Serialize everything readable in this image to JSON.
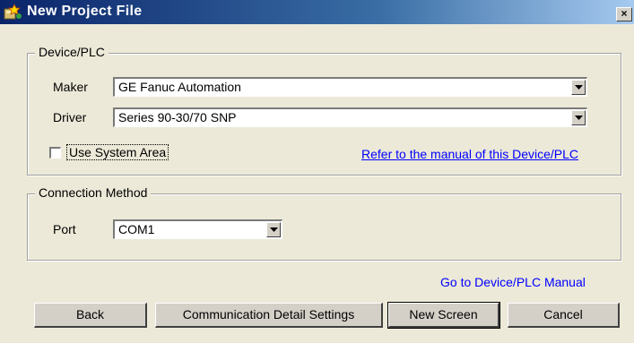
{
  "window": {
    "title": "New Project File",
    "close_label": "×"
  },
  "device_group": {
    "legend": "Device/PLC",
    "maker_label": "Maker",
    "maker_value": "GE Fanuc Automation",
    "driver_label": "Driver",
    "driver_value": "Series 90-30/70 SNP",
    "use_system_area_label": "Use System Area",
    "use_system_area_checked": false,
    "manual_link": "Refer to the manual of this Device/PLC"
  },
  "connection_group": {
    "legend": "Connection Method",
    "port_label": "Port",
    "port_value": "COM1"
  },
  "footer": {
    "manual_link": "Go to Device/PLC Manual",
    "back_label": "Back",
    "comm_settings_label": "Communication Detail Settings",
    "new_screen_label": "New Screen",
    "cancel_label": "Cancel"
  }
}
